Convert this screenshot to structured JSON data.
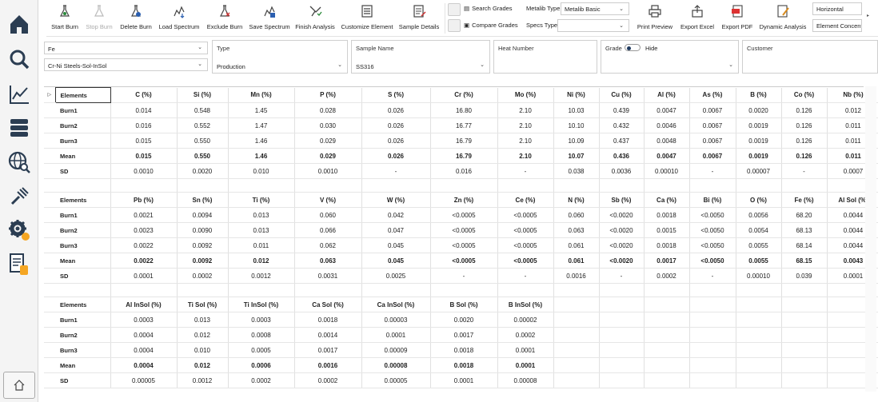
{
  "toolbar": {
    "start_burn": "Start Burn",
    "stop_burn": "Stop Burn",
    "delete_burn": "Delete Burn",
    "load_spectrum": "Load Spectrum",
    "exclude_burn": "Exclude Burn",
    "save_spectrum": "Save Spectrum",
    "finish_analysis": "Finish Analysis",
    "customize_element": "Customize Element",
    "sample_details": "Sample Details",
    "search_grades": "Search Grades",
    "compare_grades": "Compare Grades",
    "metalib_type_label": "Metalib Type",
    "metalib_type_value": "Metalib Basic",
    "specs_type_label": "Specs Type",
    "specs_type_value": "",
    "print_preview": "Print Preview",
    "export_excel": "Export Excel",
    "export_pdf": "Export PDF",
    "dynamic_analysis": "Dynamic Analysis",
    "orientation": "Horizontal",
    "element_conc": "Element Concentr"
  },
  "filters": {
    "base": "Fe",
    "program": "Cr-Ni Steels-Sol-InSol",
    "type_label": "Type",
    "type_value": "Production",
    "sample_name_label": "Sample Name",
    "sample_name_value": "SS316",
    "heat_number_label": "Heat Number",
    "grade_label": "Grade",
    "hide_label": "Hide",
    "customer_label": "Customer"
  },
  "table1": {
    "headers": [
      "Elements",
      "C (%)",
      "Si (%)",
      "Mn (%)",
      "P (%)",
      "S (%)",
      "Cr (%)",
      "Mo (%)",
      "Ni (%)",
      "Cu (%)",
      "Al (%)",
      "As (%)",
      "B (%)",
      "Co (%)",
      "Nb (%)"
    ],
    "rows": [
      [
        "Burn1",
        "0.014",
        "0.548",
        "1.45",
        "0.028",
        "0.026",
        "16.80",
        "2.10",
        "10.03",
        "0.439",
        "0.0047",
        "0.0067",
        "0.0020",
        "0.126",
        "0.012"
      ],
      [
        "Burn2",
        "0.016",
        "0.552",
        "1.47",
        "0.030",
        "0.026",
        "16.77",
        "2.10",
        "10.10",
        "0.432",
        "0.0046",
        "0.0067",
        "0.0019",
        "0.126",
        "0.011"
      ],
      [
        "Burn3",
        "0.015",
        "0.550",
        "1.46",
        "0.029",
        "0.026",
        "16.79",
        "2.10",
        "10.09",
        "0.437",
        "0.0048",
        "0.0067",
        "0.0019",
        "0.126",
        "0.011"
      ],
      [
        "Mean",
        "0.015",
        "0.550",
        "1.46",
        "0.029",
        "0.026",
        "16.79",
        "2.10",
        "10.07",
        "0.436",
        "0.0047",
        "0.0067",
        "0.0019",
        "0.126",
        "0.011"
      ],
      [
        "SD",
        "0.0010",
        "0.0020",
        "0.010",
        "0.0010",
        "-",
        "0.016",
        "-",
        "0.038",
        "0.0036",
        "0.00010",
        "-",
        "0.00007",
        "-",
        "0.0007"
      ]
    ]
  },
  "table2": {
    "headers": [
      "Elements",
      "Pb (%)",
      "Sn (%)",
      "Ti (%)",
      "V (%)",
      "W (%)",
      "Zn (%)",
      "Ce (%)",
      "N (%)",
      "Sb (%)",
      "Ca (%)",
      "Bi (%)",
      "O (%)",
      "Fe (%)",
      "Al Sol (%)"
    ],
    "rows": [
      [
        "Burn1",
        "0.0021",
        "0.0094",
        "0.013",
        "0.060",
        "0.042",
        "<0.0005",
        "<0.0005",
        "0.060",
        "<0.0020",
        "0.0018",
        "<0.0050",
        "0.0056",
        "68.20",
        "0.0044"
      ],
      [
        "Burn2",
        "0.0023",
        "0.0090",
        "0.013",
        "0.066",
        "0.047",
        "<0.0005",
        "<0.0005",
        "0.063",
        "<0.0020",
        "0.0015",
        "<0.0050",
        "0.0054",
        "68.13",
        "0.0044"
      ],
      [
        "Burn3",
        "0.0022",
        "0.0092",
        "0.011",
        "0.062",
        "0.045",
        "<0.0005",
        "<0.0005",
        "0.061",
        "<0.0020",
        "0.0018",
        "<0.0050",
        "0.0055",
        "68.14",
        "0.0044"
      ],
      [
        "Mean",
        "0.0022",
        "0.0092",
        "0.012",
        "0.063",
        "0.045",
        "<0.0005",
        "<0.0005",
        "0.061",
        "<0.0020",
        "0.0017",
        "<0.0050",
        "0.0055",
        "68.15",
        "0.0043"
      ],
      [
        "SD",
        "0.0001",
        "0.0002",
        "0.0012",
        "0.0031",
        "0.0025",
        "-",
        "-",
        "0.0016",
        "-",
        "0.0002",
        "-",
        "0.00010",
        "0.039",
        "0.0001"
      ]
    ]
  },
  "table3": {
    "headers": [
      "Elements",
      "Al InSol (%)",
      "Ti Sol (%)",
      "Ti InSol (%)",
      "Ca Sol (%)",
      "Ca InSol (%)",
      "B Sol (%)",
      "B InSol (%)",
      "",
      "",
      "",
      "",
      "",
      "",
      ""
    ],
    "rows": [
      [
        "Burn1",
        "0.0003",
        "0.013",
        "0.0003",
        "0.0018",
        "0.00003",
        "0.0020",
        "0.00002",
        "",
        "",
        "",
        "",
        "",
        "",
        ""
      ],
      [
        "Burn2",
        "0.0004",
        "0.012",
        "0.0008",
        "0.0014",
        "0.0001",
        "0.0017",
        "0.0002",
        "",
        "",
        "",
        "",
        "",
        "",
        ""
      ],
      [
        "Burn3",
        "0.0004",
        "0.010",
        "0.0005",
        "0.0017",
        "0.00009",
        "0.0018",
        "0.0001",
        "",
        "",
        "",
        "",
        "",
        "",
        ""
      ],
      [
        "Mean",
        "0.0004",
        "0.012",
        "0.0006",
        "0.0016",
        "0.00008",
        "0.0018",
        "0.0001",
        "",
        "",
        "",
        "",
        "",
        "",
        ""
      ],
      [
        "SD",
        "0.00005",
        "0.0012",
        "0.0002",
        "0.0002",
        "0.00005",
        "0.0001",
        "0.00008",
        "",
        "",
        "",
        "",
        "",
        "",
        ""
      ]
    ]
  },
  "colors": {
    "accent": "#1e3a5f",
    "orange": "#f5a623",
    "sidebar_icon": "#2b3d52"
  }
}
